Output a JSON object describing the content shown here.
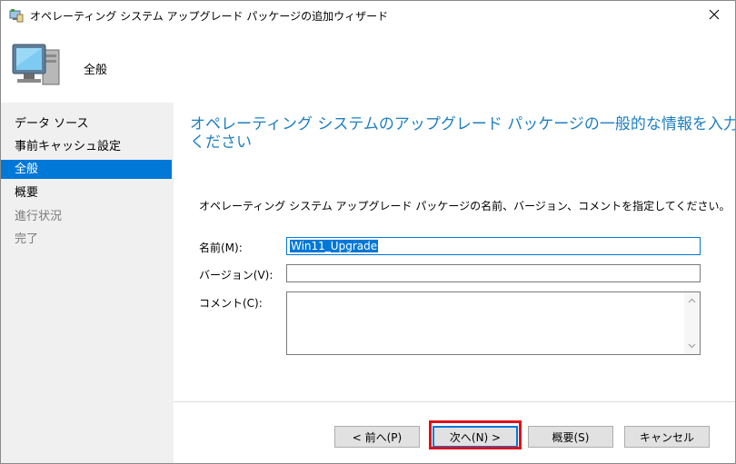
{
  "window": {
    "title": "オペレーティング システム アップグレード パッケージの追加ウィザード"
  },
  "header": {
    "title": "全般"
  },
  "sidebar": {
    "items": [
      {
        "label": "データ ソース",
        "state": "normal"
      },
      {
        "label": "事前キャッシュ設定",
        "state": "normal"
      },
      {
        "label": "全般",
        "state": "selected"
      },
      {
        "label": "概要",
        "state": "normal"
      },
      {
        "label": "進行状況",
        "state": "disabled"
      },
      {
        "label": "完了",
        "state": "disabled"
      }
    ]
  },
  "main": {
    "heading_line1": "オペレーティング システムのアップグレード パッケージの一般的な情報を入力し",
    "heading_line2": "ください",
    "instruction": "オペレーティング システム アップグレード パッケージの名前、バージョン、コメントを指定してください。",
    "fields": {
      "name_label": "名前(M):",
      "name_value": "Win11_Upgrade",
      "version_label": "バージョン(V):",
      "version_value": "",
      "comment_label": "コメント(C):",
      "comment_value": ""
    }
  },
  "buttons": {
    "back": "< 前へ(P)",
    "next": "次へ(N) >",
    "summary": "概要(S)",
    "cancel": "キャンセル"
  },
  "colors": {
    "accent": "#0078d7",
    "heading": "#1e7fc3",
    "highlight": "#e0101c",
    "sidebar_bg": "#f0f0f0"
  },
  "icons": {
    "app": "wizard-app-icon",
    "header": "computer-monitor-icon",
    "close": "close-icon"
  }
}
